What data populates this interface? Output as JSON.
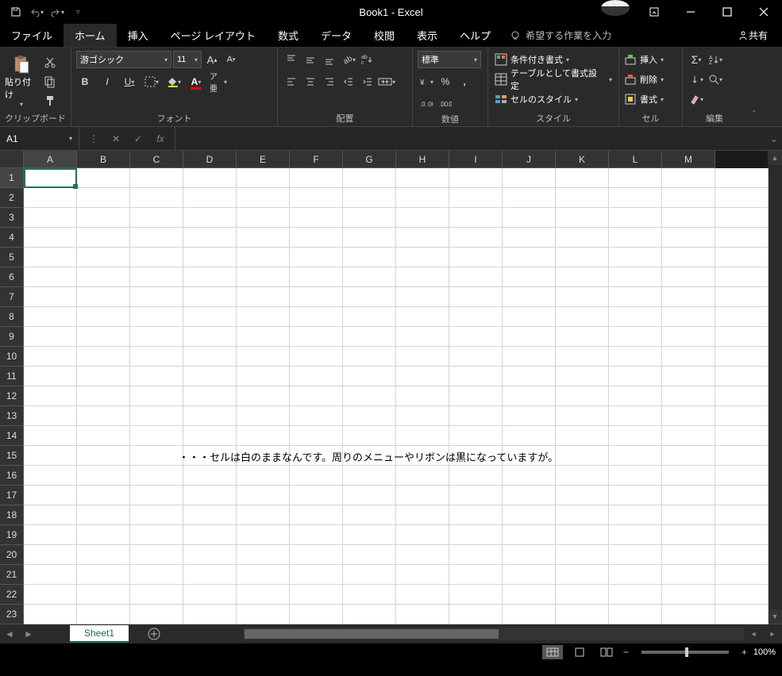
{
  "title": "Book1 - Excel",
  "qat": {
    "save": "save",
    "undo": "undo",
    "redo": "redo"
  },
  "menu": {
    "file": "ファイル",
    "home": "ホーム",
    "insert": "挿入",
    "page_layout": "ページ レイアウト",
    "formulas": "数式",
    "data": "データ",
    "review": "校閲",
    "view": "表示",
    "help": "ヘルプ",
    "tell_me": "希望する作業を入力",
    "share": "共有"
  },
  "ribbon": {
    "clipboard": {
      "label": "クリップボード",
      "paste": "貼り付け"
    },
    "font": {
      "label": "フォント",
      "name": "游ゴシック",
      "size": "11",
      "bold": "B",
      "italic": "I",
      "underline": "U"
    },
    "alignment": {
      "label": "配置"
    },
    "number": {
      "label": "数値",
      "format": "標準",
      "percent": "%",
      "comma": ","
    },
    "styles": {
      "label": "スタイル",
      "cond": "条件付き書式",
      "table": "テーブルとして書式設定",
      "cell": "セルのスタイル"
    },
    "cells": {
      "label": "セル",
      "insert": "挿入",
      "delete": "削除",
      "format": "書式"
    },
    "editing": {
      "label": "編集"
    }
  },
  "formula_bar": {
    "name_box": "A1"
  },
  "grid": {
    "columns": [
      "A",
      "B",
      "C",
      "D",
      "E",
      "F",
      "G",
      "H",
      "I",
      "J",
      "K",
      "L",
      "M"
    ],
    "rows": [
      "1",
      "2",
      "3",
      "4",
      "5",
      "6",
      "7",
      "8",
      "9",
      "10",
      "11",
      "12",
      "13",
      "14",
      "15",
      "16",
      "17",
      "18",
      "19",
      "20",
      "21",
      "22",
      "23"
    ],
    "selected_cell": "A1",
    "overlay_text": "・・・セルは白のままなんです。周りのメニューやリボンは黒になっていますが。"
  },
  "sheet": {
    "active": "Sheet1"
  },
  "status": {
    "zoom": "100%",
    "minus": "−",
    "plus": "+"
  }
}
